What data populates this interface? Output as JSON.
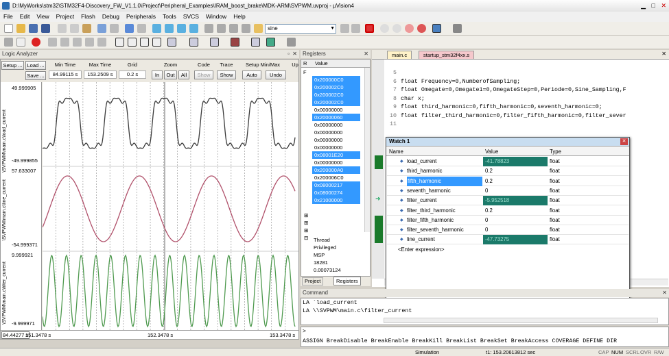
{
  "window": {
    "title": "D:\\MyWorks\\stm32\\STM32F4-Discovery_FW_V1.1.0\\Project\\Peripheral_Examples\\IRAM_boost_brake\\MDK-ARM\\SVPWM.uvproj - µVision4"
  },
  "menu": [
    "File",
    "Edit",
    "View",
    "Project",
    "Flash",
    "Debug",
    "Peripherals",
    "Tools",
    "SVCS",
    "Window",
    "Help"
  ],
  "toolbar": {
    "find_value": "sine"
  },
  "logic_analyzer": {
    "title": "Logic Analyzer",
    "setup_label": "Setup ...",
    "load_label": "Load ...",
    "save_label": "Save ...",
    "min_time_label": "Min Time",
    "max_time_label": "Max Time",
    "grid_label": "Grid",
    "zoom_label": "Zoom",
    "code_label": "Code",
    "trace_label": "Trace",
    "setup_minmax_label": "Setup Min/Max",
    "up_label": "Up",
    "min_time": "84.99115 s",
    "max_time": "153.2509 s",
    "grid": "0.2 s",
    "zoom_in": "In",
    "zoom_out": "Out",
    "zoom_all": "All",
    "code_show": "Show",
    "trace_show": "Show",
    "auto_label": "Auto",
    "undo_label": "Undo",
    "signals": [
      {
        "name": "\\SVPWM\\main.c\\load_current",
        "max": "49.999905",
        "min": "-49.999855"
      },
      {
        "name": "\\SVPWM\\main.c\\line_current",
        "max": "57.633007",
        "min": "-54.999371"
      },
      {
        "name": "\\SVPWM\\main.c\\filter_current",
        "max": "9.999921",
        "min": "-9.999971"
      }
    ],
    "time_left": "151.3478 s",
    "time_cursor": "84.44277 s",
    "time_mid": "152.3478 s",
    "time_right": "153.3478 s"
  },
  "registers": {
    "title": "Registers",
    "col_r": "R",
    "col_value": "Value",
    "col_f": "F",
    "rows": [
      {
        "value": "0x200000C0",
        "selected": true
      },
      {
        "value": "0x200002C0",
        "selected": true
      },
      {
        "value": "0x200002C0",
        "selected": true
      },
      {
        "value": "0x200002C0",
        "selected": true
      },
      {
        "value": "0x00000000",
        "selected": false
      },
      {
        "value": "0x20000060",
        "selected": true
      },
      {
        "value": "0x00000000",
        "selected": false
      },
      {
        "value": "0x00000000",
        "selected": false
      },
      {
        "value": "0x00000000",
        "selected": false
      },
      {
        "value": "0x00000000",
        "selected": false
      },
      {
        "value": "0x08001E20",
        "selected": true
      },
      {
        "value": "0x00000000",
        "selected": false
      },
      {
        "value": "0x200000A0",
        "selected": true
      },
      {
        "value": "0x200006C0",
        "selected": false
      },
      {
        "value": "0x08000217",
        "selected": true
      },
      {
        "value": "0x08000274",
        "selected": true
      },
      {
        "value": "0x21000000",
        "selected": true
      }
    ],
    "extra": [
      "Thread",
      "Privileged",
      "MSP",
      "18281",
      "0.00073124"
    ],
    "tab_project": "Project",
    "tab_registers": "Registers"
  },
  "editor": {
    "tab1": "main.c",
    "tab2": "startup_stm32f4xx.s",
    "lines": [
      {
        "num": "5",
        "text": ""
      },
      {
        "num": "6",
        "text": "float Frequency=0,NumberofSampling;"
      },
      {
        "num": "7",
        "text": "float Omegate=0,Omegate1=0,OmegateStep=0,Periode=0,Sine_Sampling,F"
      },
      {
        "num": "8",
        "text": "char x;"
      },
      {
        "num": "9",
        "text": "float third_harmonic=0,fifth_harmonic=0,seventh_harmonic=0;"
      },
      {
        "num": "10",
        "text": "float filter_third_harmonic=0,filter_fifth_harmonic=0,filter_sever"
      },
      {
        "num": "11",
        "text": ""
      }
    ]
  },
  "watch": {
    "title": "Watch 1",
    "col_name": "Name",
    "col_value": "Value",
    "col_type": "Type",
    "rows": [
      {
        "name": "load_current",
        "value": "-41.78823",
        "type": "float",
        "hl": true,
        "sel": false
      },
      {
        "name": "third_harmonic",
        "value": "0.2",
        "type": "float",
        "hl": false,
        "sel": false
      },
      {
        "name": "fifth_harmonic",
        "value": "0.2",
        "type": "float",
        "hl": false,
        "sel": true
      },
      {
        "name": "seventh_harmonic",
        "value": "0",
        "type": "float",
        "hl": false,
        "sel": false
      },
      {
        "name": "filter_current",
        "value": "-5.952518",
        "type": "float",
        "hl": true,
        "sel": false
      },
      {
        "name": "filter_third_harmonic",
        "value": "0.2",
        "type": "float",
        "hl": false,
        "sel": false
      },
      {
        "name": "filter_fifth_harmonic",
        "value": "0",
        "type": "float",
        "hl": false,
        "sel": false
      },
      {
        "name": "filter_seventh_harmonic",
        "value": "0",
        "type": "float",
        "hl": false,
        "sel": false
      },
      {
        "name": "line_current",
        "value": "-47.73275",
        "type": "float",
        "hl": true,
        "sel": false
      }
    ],
    "enter_expression": "<Enter expression>"
  },
  "command": {
    "title": "Command",
    "lines": [
      "LA `load_current",
      "LA \\\\SVPWM\\main.c\\filter_current"
    ],
    "prompt": ">",
    "keywords": "ASSIGN BreakDisable BreakEnable BreakKill BreakList BreakSet BreakAccess COVERAGE DEFINE DIR"
  },
  "status": {
    "simulation": "Simulation",
    "time": "t1: 153.20613812 sec",
    "cap": "CAP",
    "num": "NUM",
    "scrl": "SCRL",
    "ovr": "OVR",
    "rw": "R/W"
  },
  "colors": {
    "trace1": "#3a3a3a",
    "trace2": "#b0506a",
    "trace3": "#4f9a4f",
    "watch_hl": "#1b7a6a",
    "reg_sel": "#3399ff"
  }
}
